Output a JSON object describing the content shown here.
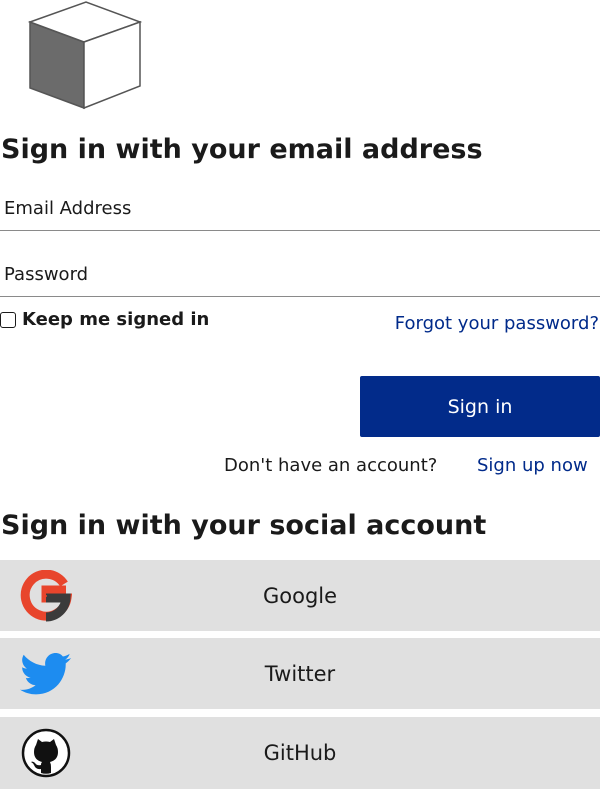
{
  "logo": {
    "icon": "cube-logo-icon"
  },
  "email_section": {
    "heading": "Sign in with your email address",
    "email_placeholder": "Email Address",
    "email_value": "",
    "password_placeholder": "Password",
    "password_value": "",
    "keep_signed_in_label": "Keep me signed in",
    "keep_signed_in_checked": false,
    "forgot_password_link": "Forgot your password?",
    "signin_button": "Sign in",
    "no_account_text": "Don't have an account?",
    "signup_link": "Sign up now"
  },
  "social_section": {
    "heading": "Sign in with your social account",
    "providers": [
      {
        "label": "Google",
        "icon": "google-icon"
      },
      {
        "label": "Twitter",
        "icon": "twitter-icon"
      },
      {
        "label": "GitHub",
        "icon": "github-icon"
      }
    ]
  },
  "colors": {
    "primary": "#022b8a",
    "link": "#002a8a",
    "social_button_bg": "#e0e0e0",
    "text": "#1a1a1a"
  }
}
